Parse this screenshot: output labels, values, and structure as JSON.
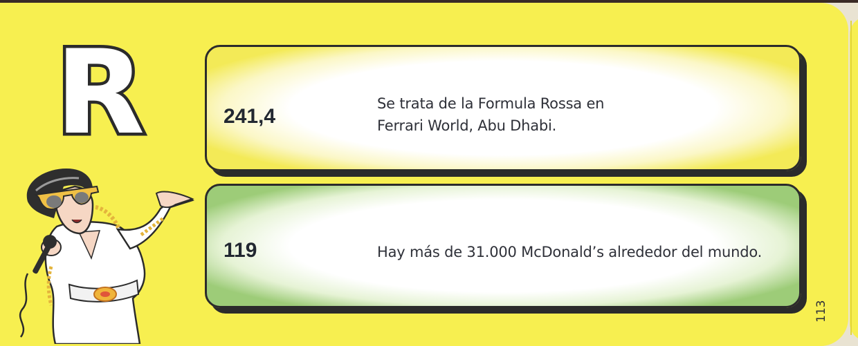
{
  "letter": "R",
  "facts": [
    {
      "number": "241,4",
      "text_line1": "Se trata de la Formula Rossa en",
      "text_line2": "Ferrari World, Abu Dhabi."
    },
    {
      "number": "119",
      "text_line1": "Hay más de 31.000 McDonald’s alrededor del mundo."
    }
  ],
  "page_number": "113",
  "colors": {
    "card_background": "#f7ef50",
    "yellow_box_edge": "#f3ea57",
    "green_box_edge": "#9dcc78",
    "outline": "#2b2b2b"
  },
  "illustration": "elvis-singer-with-microphone"
}
